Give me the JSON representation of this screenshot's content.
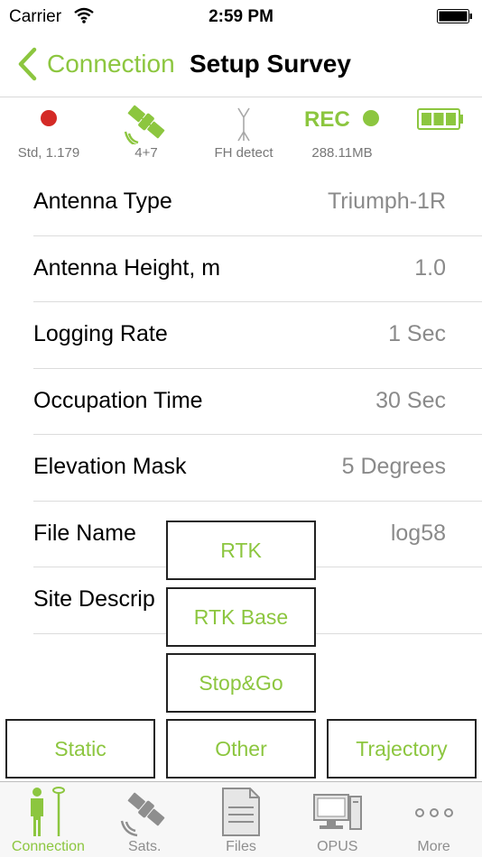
{
  "status_bar": {
    "carrier": "Carrier",
    "time": "2:59 PM"
  },
  "nav": {
    "back_label": "Connection",
    "title": "Setup Survey"
  },
  "status_strip": {
    "solution": {
      "icon": "red-dot-icon",
      "label": "Std, 1.179"
    },
    "satellites": {
      "icon": "satellite-icon",
      "label": "4+7"
    },
    "radio": {
      "icon": "antenna-icon",
      "label": "FH detect"
    },
    "recording": {
      "rec_text": "REC",
      "label": "288.11MB"
    },
    "battery": {
      "icon": "battery-icon",
      "level": 1.0
    }
  },
  "settings": [
    {
      "label": "Antenna Type",
      "value": "Triumph-1R"
    },
    {
      "label": "Antenna Height, m",
      "value": "1.0"
    },
    {
      "label": "Logging Rate",
      "value": "1 Sec"
    },
    {
      "label": "Occupation Time",
      "value": "30 Sec"
    },
    {
      "label": "Elevation Mask",
      "value": "5 Degrees"
    },
    {
      "label": "File Name",
      "value": "log58"
    },
    {
      "label": "Site Descrip",
      "value": ""
    }
  ],
  "mode_buttons": {
    "rtk": "RTK",
    "rtk_base": "RTK Base",
    "stop_go": "Stop&Go",
    "static": "Static",
    "other": "Other",
    "trajectory": "Trajectory"
  },
  "tabs": [
    {
      "label": "Connection",
      "icon": "surveyor-icon",
      "active": true
    },
    {
      "label": "Sats.",
      "icon": "satellite-icon",
      "active": false
    },
    {
      "label": "Files",
      "icon": "document-icon",
      "active": false
    },
    {
      "label": "OPUS",
      "icon": "computer-icon",
      "active": false
    },
    {
      "label": "More",
      "icon": "more-dots-icon",
      "active": false
    }
  ],
  "colors": {
    "accent": "#8cc63f",
    "record_dot": "#d42a26",
    "value_text": "#8a8a8a"
  }
}
